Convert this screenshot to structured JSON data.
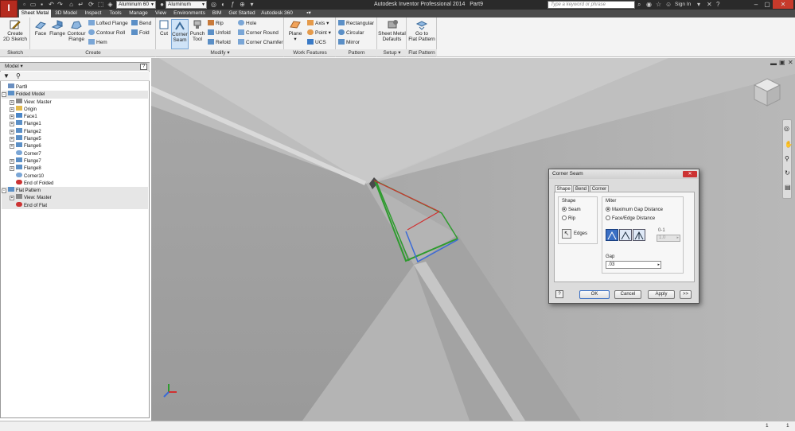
{
  "app": {
    "logo_letter": "I",
    "title": "Autodesk Inventor Professional 2014",
    "document": "Part9",
    "material": "Aluminum 60",
    "appearance": "Aluminum",
    "search_placeholder": "Type a keyword or phrase",
    "sign_in": "Sign In"
  },
  "tabs": [
    "Sheet Metal",
    "3D Model",
    "Inspect",
    "Tools",
    "Manage",
    "View",
    "Environments",
    "BIM",
    "Get Started",
    "Autodesk 360"
  ],
  "active_tab": "Sheet Metal",
  "ribbon": {
    "sketch": {
      "title": "Sketch",
      "create2d": "Create\n2D Sketch"
    },
    "create": {
      "title": "Create",
      "face": "Face",
      "flange": "Flange",
      "contour_flange": "Contour\nFlange",
      "lofted_flange": "Lofted Flange",
      "contour_roll": "Contour Roll",
      "hem": "Hem",
      "bend": "Bend",
      "fold": "Fold"
    },
    "modify": {
      "title": "Modify",
      "cut": "Cut",
      "corner_seam": "Corner\nSeam",
      "punch_tool": "Punch\nTool",
      "rip": "Rip",
      "unfold": "Unfold",
      "refold": "Refold",
      "hole": "Hole",
      "corner_round": "Corner Round",
      "corner_chamfer": "Corner Chamfer"
    },
    "work_features": {
      "title": "Work Features",
      "plane": "Plane",
      "axis": "Axis",
      "point": "Point",
      "ucs": "UCS"
    },
    "pattern": {
      "title": "Pattern",
      "rectangular": "Rectangular",
      "circular": "Circular",
      "mirror": "Mirror"
    },
    "setup": {
      "title": "Setup",
      "defaults": "Sheet Metal\nDefaults"
    },
    "flat_pattern": {
      "title": "Flat Pattern",
      "goto": "Go to\nFlat Pattern"
    }
  },
  "browser": {
    "header": "Model",
    "items": [
      {
        "label": "Part9",
        "level": 0,
        "expand": "",
        "icon": "part",
        "hl": false
      },
      {
        "label": "Folded Model",
        "level": 0,
        "expand": "-",
        "icon": "folded",
        "hl": true
      },
      {
        "label": "View: Master",
        "level": 1,
        "expand": "+",
        "icon": "view",
        "hl": false
      },
      {
        "label": "Origin",
        "level": 1,
        "expand": "+",
        "icon": "folder",
        "hl": false
      },
      {
        "label": "Face1",
        "level": 1,
        "expand": "+",
        "icon": "face",
        "hl": false
      },
      {
        "label": "Flange1",
        "level": 1,
        "expand": "+",
        "icon": "flange",
        "hl": false
      },
      {
        "label": "Flange2",
        "level": 1,
        "expand": "+",
        "icon": "flange",
        "hl": false
      },
      {
        "label": "Flange5",
        "level": 1,
        "expand": "+",
        "icon": "flange",
        "hl": false
      },
      {
        "label": "Flange6",
        "level": 1,
        "expand": "+",
        "icon": "flange",
        "hl": false
      },
      {
        "label": "Corner7",
        "level": 1,
        "expand": "",
        "icon": "corner",
        "hl": false
      },
      {
        "label": "Flange7",
        "level": 1,
        "expand": "+",
        "icon": "flange",
        "hl": false
      },
      {
        "label": "Flange8",
        "level": 1,
        "expand": "+",
        "icon": "flange",
        "hl": false
      },
      {
        "label": "Corner10",
        "level": 1,
        "expand": "",
        "icon": "corner",
        "hl": false
      },
      {
        "label": "End of Folded",
        "level": 1,
        "expand": "",
        "icon": "end",
        "hl": false
      },
      {
        "label": "Flat Pattern",
        "level": 0,
        "expand": "-",
        "icon": "flat",
        "hl": true
      },
      {
        "label": "View: Master",
        "level": 1,
        "expand": "+",
        "icon": "view",
        "hl": true
      },
      {
        "label": "End of Flat",
        "level": 1,
        "expand": "",
        "icon": "end",
        "hl": true
      }
    ]
  },
  "dialog": {
    "title": "Corner Seam",
    "tabs": [
      "Shape",
      "Bend",
      "Corner"
    ],
    "shape_group": "Shape",
    "seam": "Seam",
    "rip": "Rip",
    "edges": "Edges",
    "miter_group": "Miter",
    "max_gap": "Maximum Gap Distance",
    "face_edge": "Face/Edge Distance",
    "ratio_label": "0-1",
    "ratio_value": "1.0",
    "gap_label": "Gap",
    "gap_value": ".03",
    "ok": "OK",
    "cancel": "Cancel",
    "apply": "Apply",
    "more": ">>"
  },
  "status": {
    "left": "1",
    "right": "1"
  },
  "colors": {
    "accent": "#2a6fc4",
    "ribbon": "#f3f3f3",
    "titlebar": "#2a2a2a"
  }
}
